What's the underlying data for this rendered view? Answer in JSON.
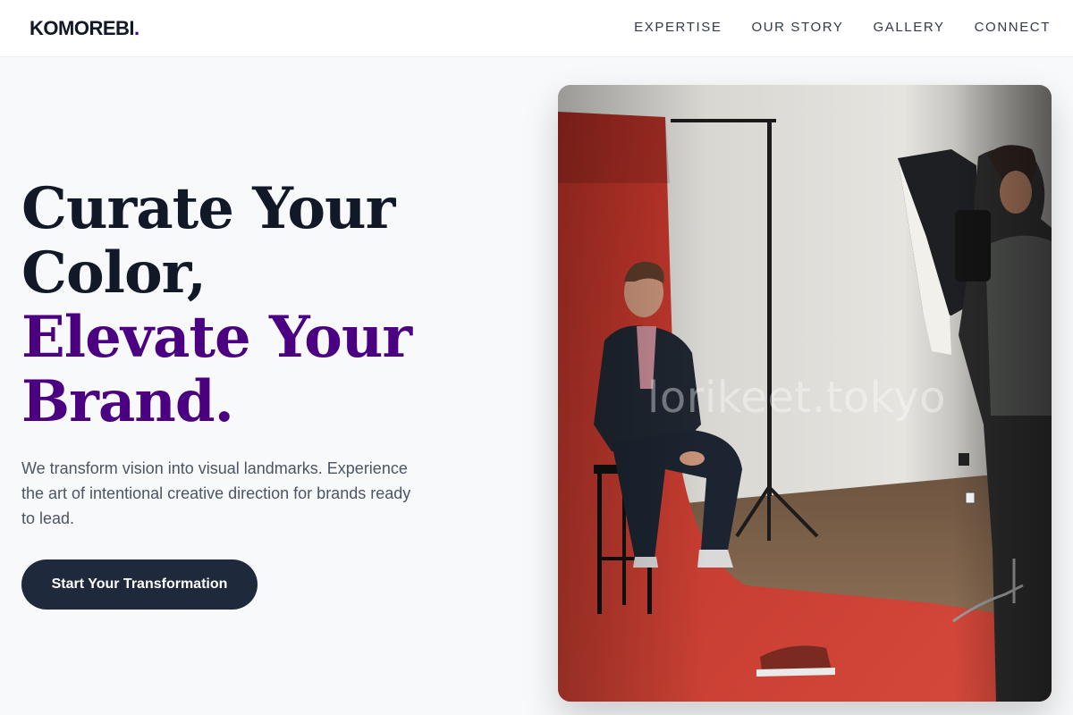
{
  "header": {
    "brand": "KOMOREBI",
    "brand_dot": ".",
    "nav": [
      {
        "label": "EXPERTISE"
      },
      {
        "label": "OUR STORY"
      },
      {
        "label": "GALLERY"
      },
      {
        "label": "CONNECT"
      }
    ]
  },
  "hero": {
    "headline_line1": "Curate Your",
    "headline_line2": "Color,",
    "headline_line3": "Elevate Your",
    "headline_line4": "Brand.",
    "subtext": "We transform vision into visual landmarks. Experience the art of intentional creative direction for brands ready to lead.",
    "cta_label": "Start Your Transformation"
  },
  "image": {
    "watermark": "lorikeet.tokyo"
  },
  "colors": {
    "accent": "#4b0082",
    "dark": "#111827",
    "button": "#1e293b",
    "backdrop_red": "#c8372c"
  }
}
